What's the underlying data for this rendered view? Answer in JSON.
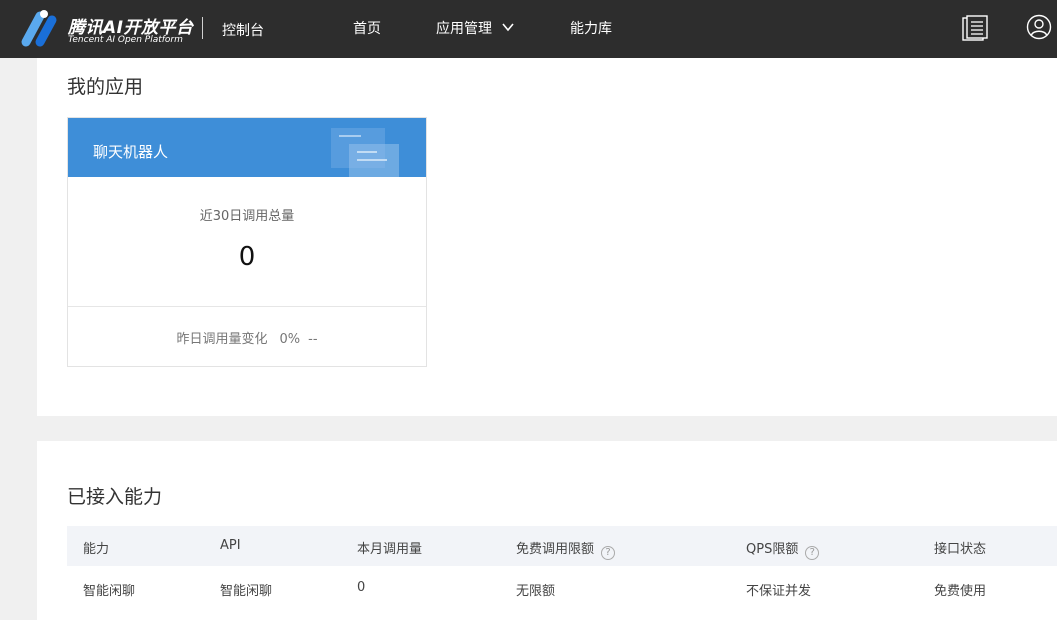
{
  "header": {
    "brand_cn": "腾讯AI开放平台",
    "brand_en": "Tencent AI Open Platform",
    "console": "控制台",
    "nav": [
      {
        "label": "首页"
      },
      {
        "label": "应用管理"
      },
      {
        "label": "能力库"
      }
    ],
    "logo_colors": [
      "#5aa9ee",
      "#1a6fd8"
    ]
  },
  "my_apps": {
    "title": "我的应用",
    "card": {
      "name": "聊天机器人",
      "calls_label": "近30日调用总量",
      "calls_value": "0",
      "change_label": "昨日调用量变化",
      "change_value": "0%",
      "change_trend": "--",
      "header_color": "#3e8ed8"
    }
  },
  "capabilities": {
    "title": "已接入能力",
    "columns": [
      "能力",
      "API",
      "本月调用量",
      "免费调用限额",
      "QPS限额",
      "接口状态"
    ],
    "rows": [
      [
        "智能闲聊",
        "智能闲聊",
        "0",
        "无限额",
        "不保证并发",
        "免费使用"
      ]
    ],
    "help_glyph": "?"
  }
}
